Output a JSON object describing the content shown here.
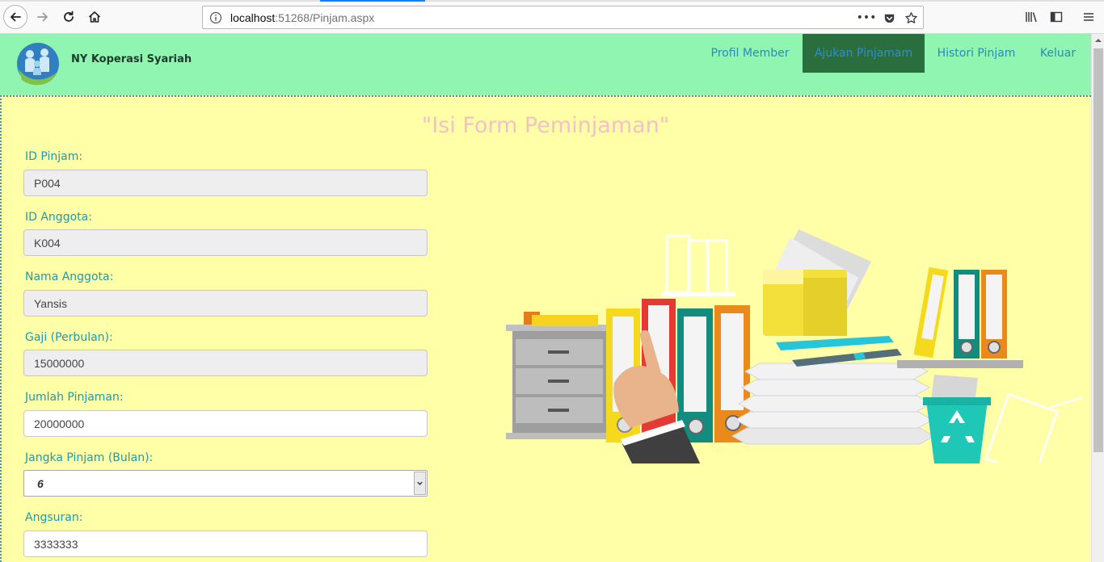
{
  "browser": {
    "url_host": "localhost",
    "url_rest": ":51268/Pinjam.aspx"
  },
  "header": {
    "brand": "NY Koperasi Syariah",
    "menu": [
      {
        "label": "Profil Member",
        "active": false
      },
      {
        "label": "Ajukan Pinjamam",
        "active": true
      },
      {
        "label": "Histori Pinjam",
        "active": false
      },
      {
        "label": "Keluar",
        "active": false
      }
    ]
  },
  "form": {
    "title": "\"Isi Form Peminjaman\"",
    "fields": [
      {
        "label": "ID Pinjam:",
        "value": "P004",
        "readonly": true
      },
      {
        "label": "ID Anggota:",
        "value": "K004",
        "readonly": true
      },
      {
        "label": "Nama Anggota:",
        "value": "Yansis",
        "readonly": true
      },
      {
        "label": "Gaji (Perbulan):",
        "value": "15000000",
        "readonly": true
      },
      {
        "label": "Jumlah Pinjaman:",
        "value": "20000000",
        "readonly": false
      },
      {
        "label": "Jangka Pinjam (Bulan):",
        "value": "6",
        "type": "select"
      },
      {
        "label": "Angsuran:",
        "value": "3333333",
        "readonly": false
      }
    ]
  },
  "colors": {
    "header_bg": "#8ff5b0",
    "page_bg": "#ffffa8",
    "active_menu_bg": "#2a6e3e",
    "label_color": "#1f9aaa",
    "title_color": "#f6c0c8"
  }
}
